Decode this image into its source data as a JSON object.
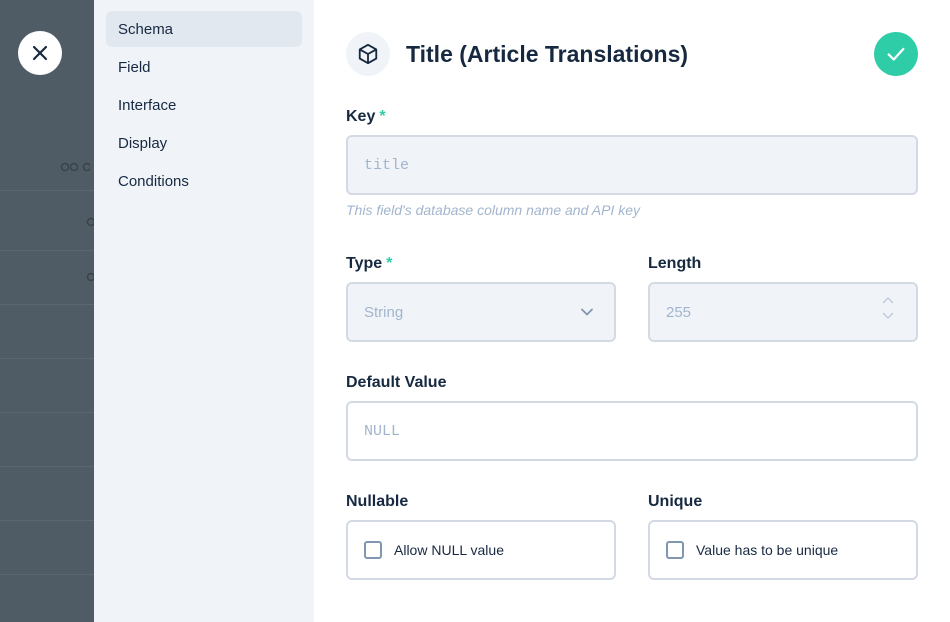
{
  "nav": {
    "items": [
      {
        "label": "Schema",
        "active": true
      },
      {
        "label": "Field",
        "active": false
      },
      {
        "label": "Interface",
        "active": false
      },
      {
        "label": "Display",
        "active": false
      },
      {
        "label": "Conditions",
        "active": false
      }
    ]
  },
  "header": {
    "title": "Title (Article Translations)",
    "icon": "box-icon"
  },
  "form": {
    "key": {
      "label": "Key",
      "required_mark": "*",
      "placeholder": "title",
      "hint": "This field's database column name and API key"
    },
    "type": {
      "label": "Type",
      "required_mark": "*",
      "value": "String"
    },
    "length": {
      "label": "Length",
      "value": "255"
    },
    "default_value": {
      "label": "Default Value",
      "placeholder": "NULL"
    },
    "nullable": {
      "label": "Nullable",
      "checkbox_label": "Allow NULL value",
      "checked": false
    },
    "unique": {
      "label": "Unique",
      "checkbox_label": "Value has to be unique",
      "checked": false
    }
  },
  "colors": {
    "accent": "#2ecda7",
    "text": "#172940",
    "muted": "#a2b5cd",
    "nav_bg": "#f0f4f9",
    "backdrop": "#4f5c66"
  }
}
